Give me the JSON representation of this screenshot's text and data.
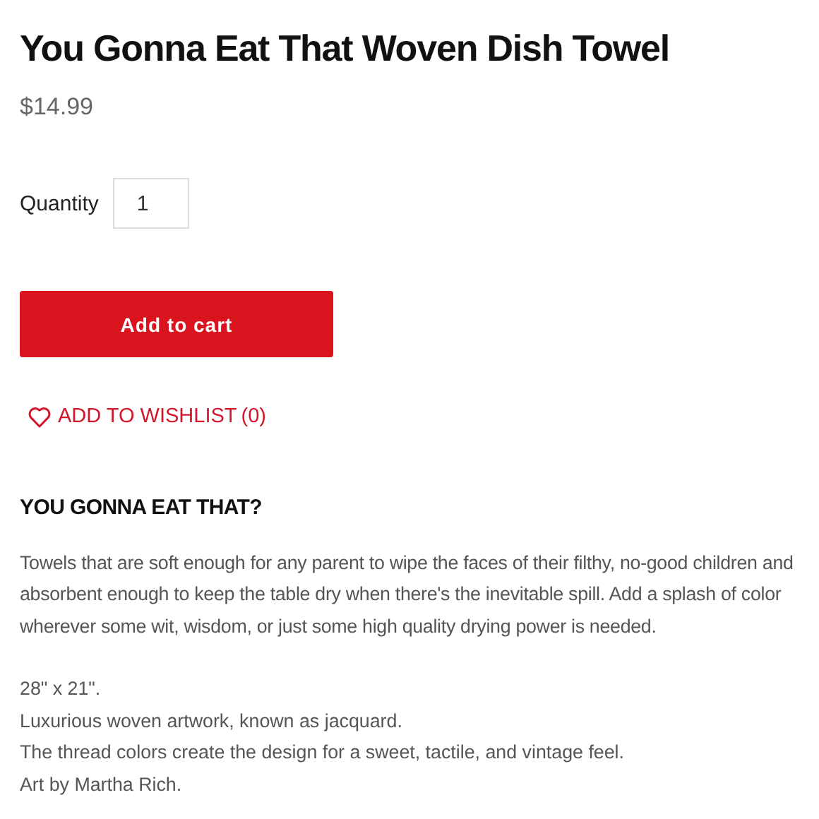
{
  "product": {
    "title": "You Gonna Eat That Woven Dish Towel",
    "price": "$14.99"
  },
  "quantity": {
    "label": "Quantity",
    "value": "1"
  },
  "add_to_cart": "Add to cart",
  "wishlist": {
    "label": "ADD TO WISHLIST",
    "count": "(0)"
  },
  "description": {
    "heading": "YOU GONNA EAT THAT?",
    "paragraph": "Towels that are soft enough for any parent to wipe the faces of their filthy, no-good children and absorbent enough to keep the table dry when there's the inevitable spill. Add a splash of color wherever some wit, wisdom, or just some high quality drying power is needed.",
    "lines": [
      "28\" x 21\".",
      "Luxurious woven artwork, known as jacquard.",
      "The thread colors create the design for a sweet, tactile, and vintage feel.",
      "Art by Martha Rich."
    ]
  }
}
